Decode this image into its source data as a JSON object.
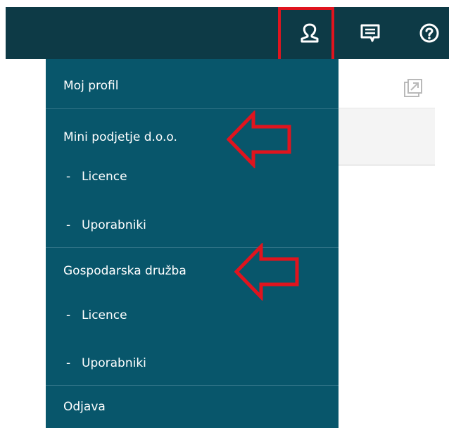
{
  "topbar": {
    "icons": {
      "profile": "user-profile-icon",
      "messages": "message-icon",
      "help": "help-circle-icon"
    }
  },
  "background": {
    "icon": "open-external-icon"
  },
  "menu": {
    "items": [
      {
        "label": "Moj profil"
      },
      {
        "label": "Mini podjetje d.o.o."
      },
      {
        "dash": "-",
        "label": "Licence"
      },
      {
        "dash": "-",
        "label": "Uporabniki"
      },
      {
        "label": "Gospodarska družba"
      },
      {
        "dash": "-",
        "label": "Licence"
      },
      {
        "dash": "-",
        "label": "Uporabniki"
      },
      {
        "label": "Odjava"
      }
    ]
  },
  "annotations": {
    "highlight_color": "#e0141e",
    "arrow_icon": "left-arrow-icon"
  },
  "colors": {
    "topbar_bg": "#0d3a46",
    "menu_bg": "#08566b",
    "menu_text": "#ffffff",
    "annotation": "#e0141e"
  }
}
